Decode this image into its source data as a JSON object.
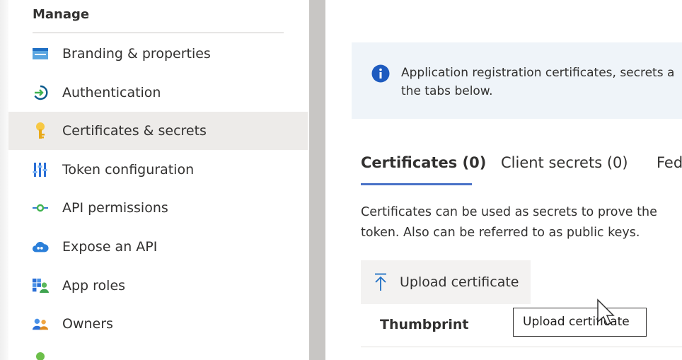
{
  "sidebar": {
    "section_title": "Manage",
    "items": [
      {
        "label": "Branding & properties",
        "icon": "branding-icon"
      },
      {
        "label": "Authentication",
        "icon": "authentication-icon"
      },
      {
        "label": "Certificates & secrets",
        "icon": "key-icon",
        "selected": true
      },
      {
        "label": "Token configuration",
        "icon": "token-configuration-icon"
      },
      {
        "label": "API permissions",
        "icon": "api-permissions-icon"
      },
      {
        "label": "Expose an API",
        "icon": "cloud-api-icon"
      },
      {
        "label": "App roles",
        "icon": "app-roles-icon"
      },
      {
        "label": "Owners",
        "icon": "owners-icon"
      }
    ]
  },
  "main": {
    "banner": {
      "icon": "info-icon",
      "text_line1": "Application registration certificates, secrets a",
      "text_line2": "the tabs below."
    },
    "tabs": [
      {
        "label": "Certificates (0)",
        "active": true
      },
      {
        "label": "Client secrets (0)",
        "active": false
      },
      {
        "label": "Fed",
        "active": false
      }
    ],
    "description_line1": "Certificates can be used as secrets to prove the",
    "description_line2": "token. Also can be referred to as public keys.",
    "upload_button": {
      "label": "Upload certificate",
      "icon": "upload-arrow-icon"
    },
    "table": {
      "columns": [
        "Thumbprint"
      ]
    },
    "tooltip": "Upload certificate"
  },
  "colors": {
    "accent": "#4a72c7",
    "selected_bg": "#edebe9",
    "banner_bg": "#eff4f9",
    "gutter": "#c8c6c4"
  }
}
